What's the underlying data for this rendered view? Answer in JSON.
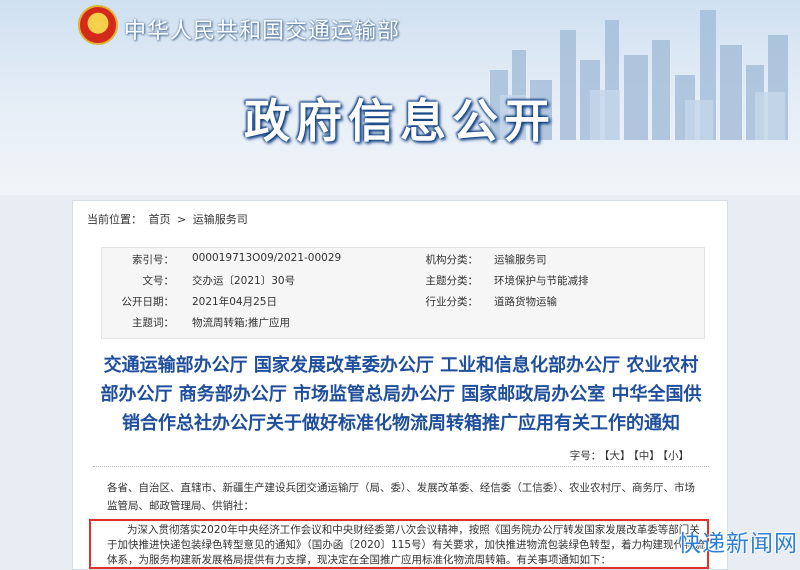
{
  "header": {
    "site_title": "中华人民共和国交通运输部",
    "banner_title": "政府信息公开"
  },
  "breadcrumb": {
    "label": "当前位置：",
    "items": [
      "首页",
      "运输服务司"
    ],
    "separator": ">"
  },
  "meta": {
    "index_label": "索引号：",
    "index_value": "000019713O09/2021-00029",
    "org_label": "机构分类：",
    "org_value": "运输服务司",
    "docno_label": "文号：",
    "docno_value": "交办运〔2021〕30号",
    "topic_label": "主题分类：",
    "topic_value": "环境保护与节能减排",
    "date_label": "公开日期：",
    "date_value": "2021年04月25日",
    "industry_label": "行业分类：",
    "industry_value": "道路货物运输",
    "keywords_label": "主题词：",
    "keywords_value": "物流周转箱;推广应用"
  },
  "document": {
    "title_lines": [
      "交通运输部办公厅 国家发展改革委办公厅 工业和信息化部办公厅 农业农村",
      "部办公厅 商务部办公厅 市场监管总局办公厅 国家邮政局办公室 中华全国供",
      "销合作总社办公厅关于做好标准化物流周转箱推广应用有关工作的通知"
    ],
    "font_size_label": "字号：",
    "font_size_options": [
      "【大】",
      "【中】",
      "【小】"
    ],
    "addressee": "各省、自治区、直辖市、新疆生产建设兵团交通运输厅（局、委）、发展改革委、经信委（工信委）、农业农村厅、商务厅、市场监管局、邮政管理局、供销社：",
    "body": "为深入贯彻落实2020年中央经济工作会议和中央财经委第八次会议精神，按照《国务院办公厅转发国家发展改革委等部门关于加快推进快递包装绿色转型意见的通知》（国办函〔2020〕115号）有关要求，加快推进物流包装绿色转型，着力构建现代物流体系，为服务构建新发展格局提供有力支撑，现决定在全国推广应用标准化物流周转箱。有关事项通知如下："
  },
  "watermark": "快递新闻网",
  "colors": {
    "title_blue": "#1f4f9c",
    "highlight_red": "#e0302a",
    "watermark_blue": "#2e7fd6"
  }
}
